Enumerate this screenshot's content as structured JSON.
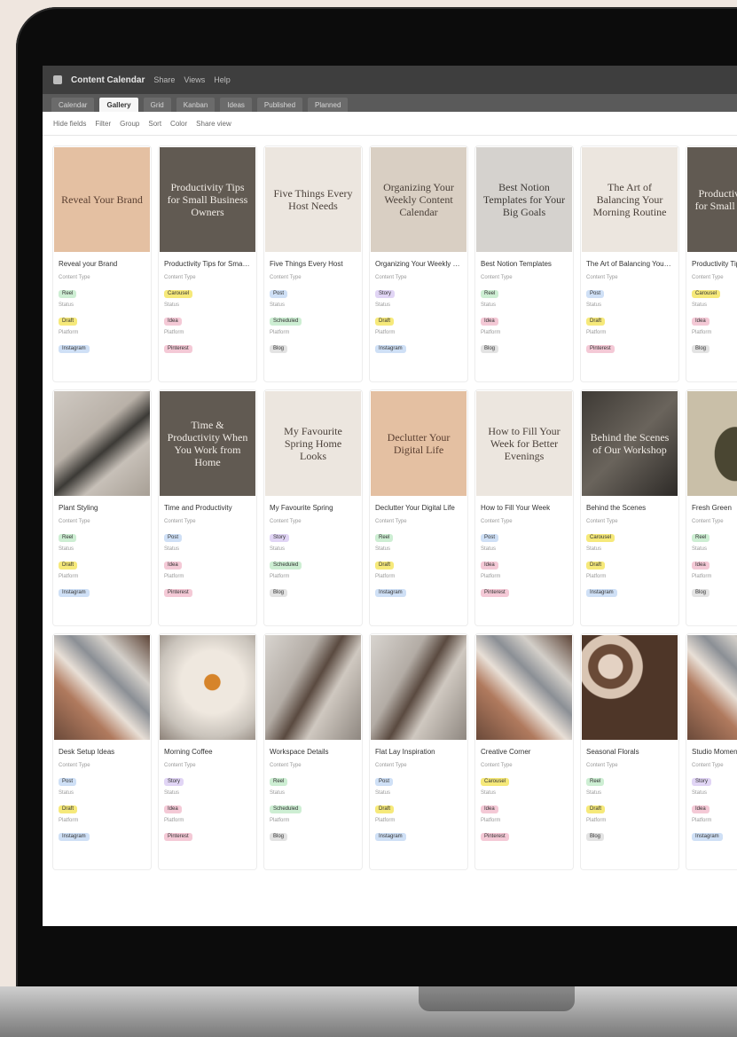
{
  "app": {
    "name": "Content Calendar",
    "menu": [
      "Share",
      "Views",
      "Help"
    ]
  },
  "view_tabs": [
    "Calendar",
    "Gallery",
    "Grid",
    "Kanban",
    "Ideas",
    "Published",
    "Planned"
  ],
  "active_tab_index": 1,
  "filters": [
    "Hide fields",
    "Filter",
    "Group",
    "Sort",
    "Color",
    "Share view"
  ],
  "colors": {
    "pill_green": "#cdeed3",
    "pill_blue": "#cfe0f6",
    "pill_yellow": "#f6e97a",
    "pill_purple": "#e1d5f5",
    "pill_pink": "#f4c9d6",
    "pill_grey": "#e3e3e3"
  },
  "field_labels": {
    "a": "Content Type",
    "b": "Status",
    "c": "Platform"
  },
  "cards": [
    {
      "title": "Reveal your Brand",
      "cover_text": "Reveal Your Brand",
      "style": "tan",
      "t": "Reel",
      "s": "Draft",
      "p": "Instagram"
    },
    {
      "title": "Productivity Tips for Small Business",
      "cover_text": "Productivity Tips for Small Business Owners",
      "style": "darkphoto",
      "t": "Carousel",
      "s": "Idea",
      "p": "Pinterest"
    },
    {
      "title": "Five Things Every Host",
      "cover_text": "Five Things Every Host Needs",
      "style": "cream",
      "t": "Post",
      "s": "Scheduled",
      "p": "Blog"
    },
    {
      "title": "Organizing Your Weekly Content",
      "cover_text": "Organizing Your Weekly Content Calendar",
      "style": "beige",
      "t": "Story",
      "s": "Draft",
      "p": "Instagram"
    },
    {
      "title": "Best Notion Templates",
      "cover_text": "Best Notion Templates for Your Big Goals",
      "style": "grey",
      "t": "Reel",
      "s": "Idea",
      "p": "Blog"
    },
    {
      "title": "The Art of Balancing Your Morning",
      "cover_text": "The Art of Balancing Your Morning Routine",
      "style": "cream",
      "t": "Post",
      "s": "Draft",
      "p": "Pinterest"
    },
    {
      "title": "Productivity Tips",
      "cover_text": "Productivity Tips for Small Business",
      "style": "darkphoto",
      "t": "Carousel",
      "s": "Idea",
      "p": "Blog"
    },
    {
      "title": "Plant Styling",
      "cover_text": "",
      "style": "leaf",
      "t": "Reel",
      "s": "Draft",
      "p": "Instagram"
    },
    {
      "title": "Time and Productivity",
      "cover_text": "Time & Productivity When You Work from Home",
      "style": "darkphoto",
      "t": "Post",
      "s": "Idea",
      "p": "Pinterest"
    },
    {
      "title": "My Favourite Spring",
      "cover_text": "My Favourite Spring Home Looks",
      "style": "cream",
      "t": "Story",
      "s": "Scheduled",
      "p": "Blog"
    },
    {
      "title": "Declutter Your Digital Life",
      "cover_text": "Declutter Your Digital Life",
      "style": "tan",
      "t": "Reel",
      "s": "Draft",
      "p": "Instagram"
    },
    {
      "title": "How to Fill Your Week",
      "cover_text": "How to Fill Your Week for Better Evenings",
      "style": "cream",
      "t": "Post",
      "s": "Idea",
      "p": "Pinterest"
    },
    {
      "title": "Behind the Scenes",
      "cover_text": "Behind the Scenes of Our Workshop",
      "style": "dark",
      "t": "Carousel",
      "s": "Draft",
      "p": "Instagram"
    },
    {
      "title": "Fresh Green",
      "cover_text": "",
      "style": "plant",
      "t": "Reel",
      "s": "Idea",
      "p": "Blog"
    },
    {
      "title": "Desk Setup Ideas",
      "cover_text": "",
      "style": "desk",
      "t": "Post",
      "s": "Draft",
      "p": "Instagram"
    },
    {
      "title": "Morning Coffee",
      "cover_text": "",
      "style": "orange",
      "t": "Story",
      "s": "Idea",
      "p": "Pinterest"
    },
    {
      "title": "Workspace Details",
      "cover_text": "",
      "style": "desk2",
      "t": "Reel",
      "s": "Scheduled",
      "p": "Blog"
    },
    {
      "title": "Flat Lay Inspiration",
      "cover_text": "",
      "style": "desk2",
      "t": "Post",
      "s": "Draft",
      "p": "Instagram"
    },
    {
      "title": "Creative Corner",
      "cover_text": "",
      "style": "desk",
      "t": "Carousel",
      "s": "Idea",
      "p": "Pinterest"
    },
    {
      "title": "Seasonal Florals",
      "cover_text": "",
      "style": "flowers",
      "t": "Reel",
      "s": "Draft",
      "p": "Blog"
    },
    {
      "title": "Studio Moments",
      "cover_text": "",
      "style": "desk",
      "t": "Story",
      "s": "Idea",
      "p": "Instagram"
    }
  ]
}
